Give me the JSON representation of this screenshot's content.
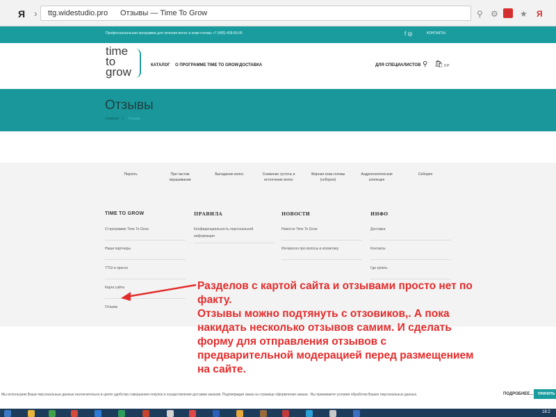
{
  "browser": {
    "logo": "Я",
    "url": "ttg.widestudio.pro",
    "tab_title": "Отзывы — Time To Grow"
  },
  "topbar": {
    "phone_text": "Профессиональная программа для лечения волос и кожи головы +7 (495) 409-66-05",
    "social": "f ◎",
    "contacts": "КОНТАКТЫ"
  },
  "header": {
    "logo_line1": "time",
    "logo_line2": "to",
    "logo_line3": "grow",
    "menu": [
      "КАТАЛОГ",
      "О ПРОГРАММЕ TIME TO GROW",
      "ДОСТАВКА"
    ],
    "specialists": "ДЛЯ СПЕЦИАЛИСТОВ",
    "cart_count": "0 Р"
  },
  "title_band": {
    "title": "Отзывы",
    "breadcrumb_home": "Главная",
    "breadcrumb_sep": "/",
    "breadcrumb_current": "Отзывы"
  },
  "categories": [
    {
      "line1": "Перхоть",
      "line2": ""
    },
    {
      "line1": "При частом",
      "line2": "окрашивании"
    },
    {
      "line1": "Выпадение волос",
      "line2": ""
    },
    {
      "line1": "Снижение густоты и",
      "line2": "истончение волос"
    },
    {
      "line1": "Жирная кожа головы",
      "line2": "(себорея)"
    },
    {
      "line1": "Андрогенетическая",
      "line2": "алопеция"
    },
    {
      "line1": "Себорея",
      "line2": ""
    }
  ],
  "footer": {
    "col1": {
      "title": "TIME TO GROW",
      "links": [
        "О программе Time To Grow",
        "Наши партнеры",
        "TTGr в прессе",
        "Карта сайта",
        "Отзывы"
      ]
    },
    "col2": {
      "title": "ПРАВИЛА",
      "links": [
        "Конфиденциальность персональной",
        "информации"
      ]
    },
    "col3": {
      "title": "НОВОСТИ",
      "links": [
        "Новости Time To Grow",
        "Интересно про волосы и косметику"
      ]
    },
    "col4": {
      "title": "ИНФО",
      "links": [
        "Доставка",
        "Контакты",
        "Где купить"
      ]
    }
  },
  "annotation": {
    "line1": "Разделов с картой сайта и отзывами просто нет по",
    "line2": "факту.",
    "line3": "Отзывы можно подтянуть с отзовиков,. А пока",
    "line4": "накидать несколько отзывов самим. И сделать",
    "line5": "форму для отправления отзывов с",
    "line6": "предварительной модерацией перед размещением",
    "line7": "на сайте."
  },
  "cookie": {
    "text": "Мы используем Ваши персональные данные исключительно в целях удобства совершения покупок и осуществления доставки заказов. Подтверждая заказ на странице оформления заказа - Вы принимаете условия обработки Ваших персональных данных.",
    "more": "ПОДРОБНЕЕ...",
    "accept": "ПРИНЯТЬ"
  },
  "taskbar": {
    "time": "18:2"
  },
  "colors": {
    "teal": "#1a9c9f",
    "annotation_red": "#e32b2b"
  }
}
